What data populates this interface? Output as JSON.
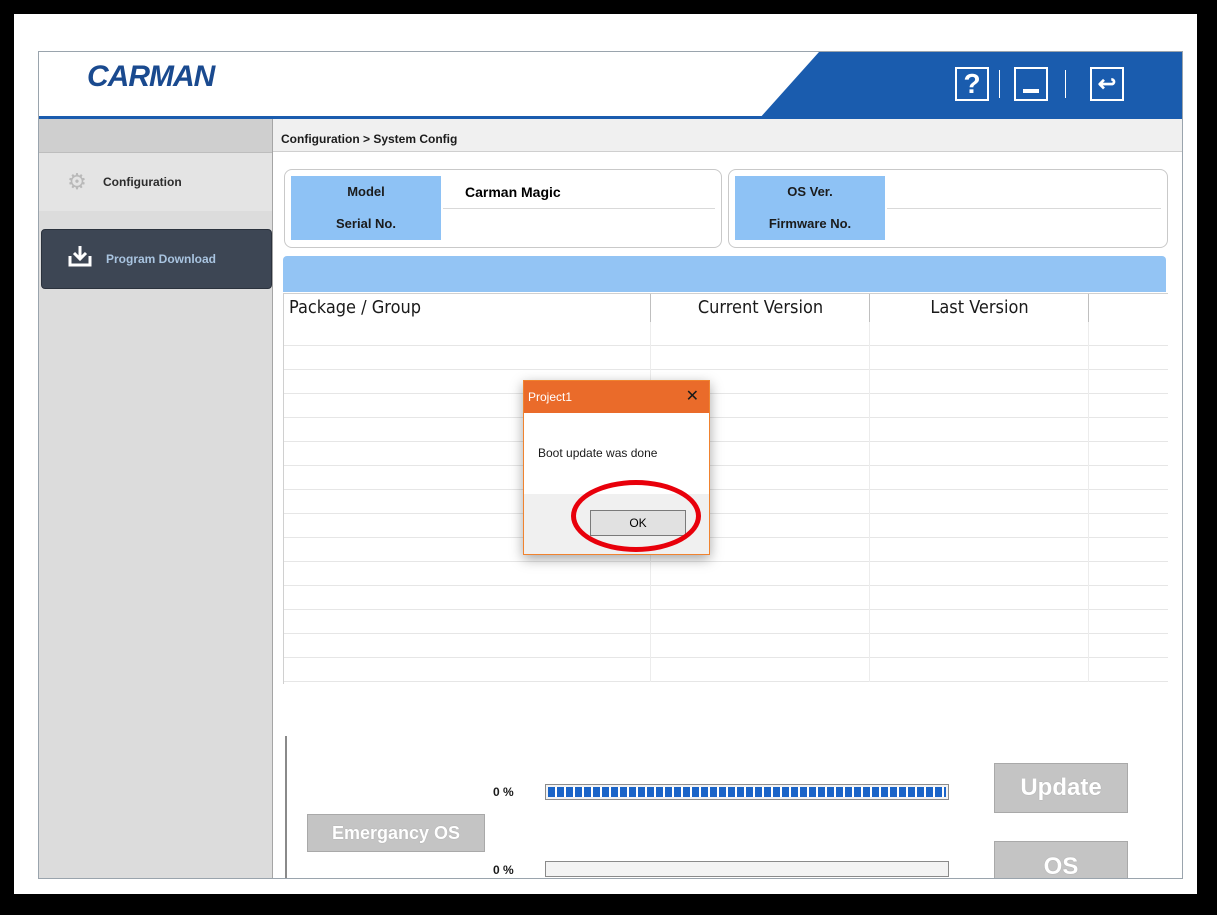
{
  "app": {
    "logo": "CARMAN"
  },
  "header": {
    "help_icon": "?",
    "back_icon": "↩"
  },
  "sidebar": {
    "items": [
      {
        "label": "Configuration",
        "icon": "gear-icon"
      },
      {
        "label": "Program Download",
        "icon": "download-icon"
      }
    ]
  },
  "breadcrumb": "Configuration > System Config",
  "info": {
    "model_label": "Model",
    "model_value": "Carman Magic",
    "serial_label": "Serial No.",
    "os_label": "OS Ver.",
    "firmware_label": "Firmware No."
  },
  "table": {
    "headers": [
      "Package / Group",
      "Current Version",
      "Last Version",
      ""
    ]
  },
  "progress": [
    {
      "label": "0 %",
      "fill": 1.0
    },
    {
      "label": "0 %",
      "fill": 0.0
    }
  ],
  "buttons": {
    "emergency": "Emergancy OS",
    "update": "Update",
    "os": "OS"
  },
  "dialog": {
    "title": "Project1",
    "close": "✕",
    "message": "Boot update was done",
    "ok": "OK"
  },
  "colors": {
    "accent": "#1a5cae",
    "highlight": "#e8000b",
    "dialog_title": "#ea6b2a"
  }
}
